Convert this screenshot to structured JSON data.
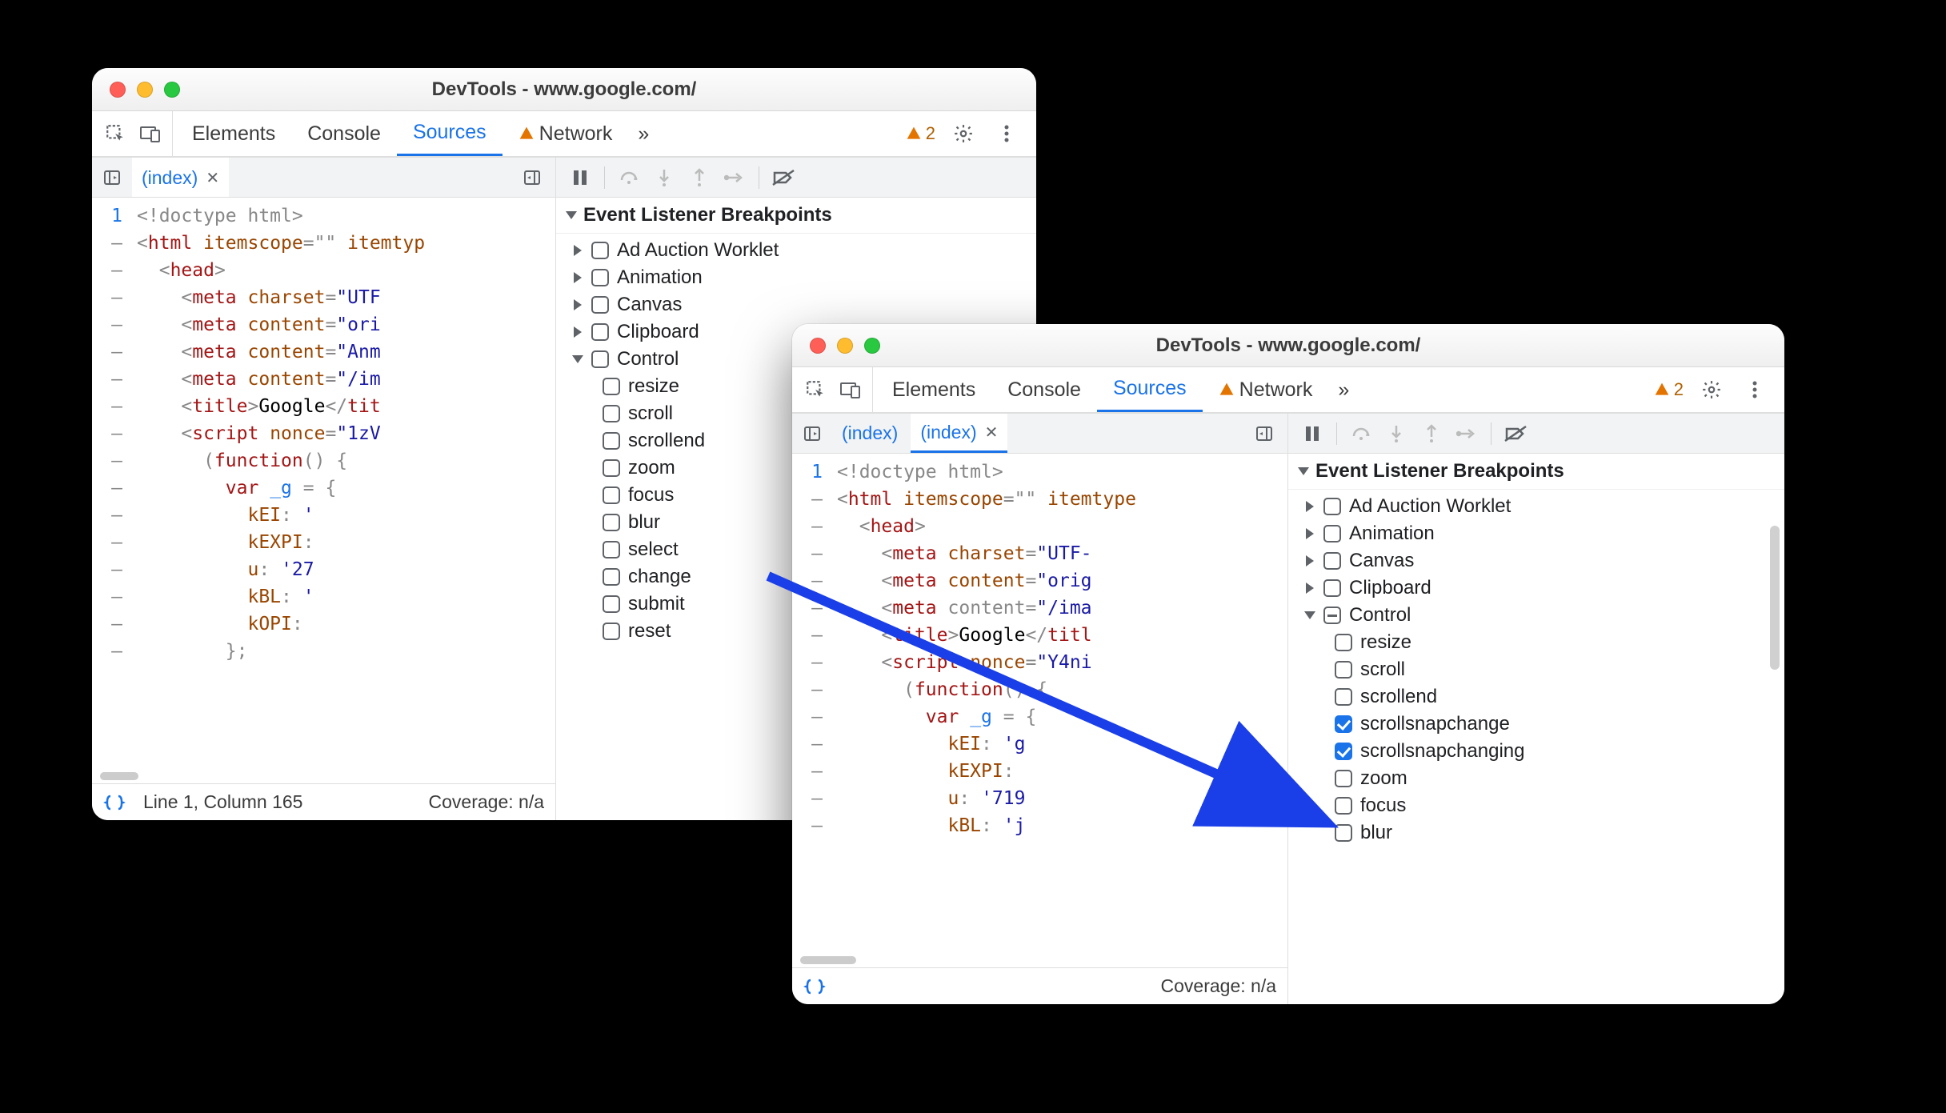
{
  "windows": {
    "w1": {
      "title": "DevTools - www.google.com/"
    },
    "w2": {
      "title": "DevTools - www.google.com/"
    }
  },
  "mainTabs": {
    "elements": "Elements",
    "console": "Console",
    "sources": "Sources",
    "network": "Network"
  },
  "warningCount": "2",
  "fileTabs": {
    "index": "(index)"
  },
  "footer": {
    "cursor": "Line 1, Column 165",
    "coverage": "Coverage: n/a"
  },
  "sectionTitle": "Event Listener Breakpoints",
  "categories": {
    "adAuction": "Ad Auction Worklet",
    "animation": "Animation",
    "canvas": "Canvas",
    "clipboard": "Clipboard",
    "control": "Control"
  },
  "controlItems": {
    "resize": "resize",
    "scroll": "scroll",
    "scrollend": "scrollend",
    "scrollsnapchange": "scrollsnapchange",
    "scrollsnapchanging": "scrollsnapchanging",
    "zoom": "zoom",
    "focus": "focus",
    "blur": "blur",
    "select": "select",
    "change": "change",
    "submit": "submit",
    "reset": "reset"
  },
  "code1": {
    "lines": [
      {
        "n": "1",
        "html": "<span class='c-gray'>&lt;!doctype html&gt;</span>"
      },
      {
        "n": "–",
        "html": "<span class='c-punc'>&lt;</span><span class='c-tag'>html</span> <span class='c-attr'>itemscope</span><span class='c-punc'>=\"\"</span> <span class='c-attr'>itemtyp</span>"
      },
      {
        "n": "–",
        "html": "  <span class='c-punc'>&lt;</span><span class='c-tag'>head</span><span class='c-punc'>&gt;</span>"
      },
      {
        "n": "–",
        "html": "    <span class='c-punc'>&lt;</span><span class='c-tag'>meta</span> <span class='c-attr'>charset</span><span class='c-punc'>=</span><span class='c-str'>\"UTF</span>"
      },
      {
        "n": "–",
        "html": "    <span class='c-punc'>&lt;</span><span class='c-tag'>meta</span> <span class='c-attr'>content</span><span class='c-punc'>=</span><span class='c-str'>\"ori</span>"
      },
      {
        "n": "–",
        "html": "    <span class='c-punc'>&lt;</span><span class='c-tag'>meta</span> <span class='c-attr'>content</span><span class='c-punc'>=</span><span class='c-str'>\"Anm</span>"
      },
      {
        "n": "–",
        "html": "    <span class='c-punc'>&lt;</span><span class='c-tag'>meta</span> <span class='c-attr'>content</span><span class='c-punc'>=</span><span class='c-str'>\"/im</span>"
      },
      {
        "n": "–",
        "html": "    <span class='c-punc'>&lt;</span><span class='c-tag'>title</span><span class='c-punc'>&gt;</span>Google<span class='c-punc'>&lt;/</span><span class='c-tag'>tit</span>"
      },
      {
        "n": "–",
        "html": "    <span class='c-punc'>&lt;</span><span class='c-tag'>script</span> <span class='c-attr'>nonce</span><span class='c-punc'>=</span><span class='c-str'>\"1zV</span>"
      },
      {
        "n": "–",
        "html": "      <span class='c-punc'>(</span><span class='c-kw'>function</span><span class='c-punc'>() {</span>"
      },
      {
        "n": "–",
        "html": "        <span class='c-kw'>var</span> <span class='c-var'>_g</span> <span class='c-punc'>= {</span>"
      },
      {
        "n": "–",
        "html": "          <span class='c-prop'>kEI</span><span class='c-punc'>:</span> <span class='c-str'>'</span>"
      },
      {
        "n": "–",
        "html": "          <span class='c-prop'>kEXPI</span><span class='c-punc'>:</span>"
      },
      {
        "n": "–",
        "html": "          <span class='c-prop'>u</span><span class='c-punc'>:</span> <span class='c-str'>'27</span>"
      },
      {
        "n": "–",
        "html": "          <span class='c-prop'>kBL</span><span class='c-punc'>:</span> <span class='c-str'>'</span>"
      },
      {
        "n": "–",
        "html": "          <span class='c-prop'>kOPI</span><span class='c-punc'>:</span>"
      },
      {
        "n": "–",
        "html": "        <span class='c-punc'>};</span>"
      }
    ]
  },
  "code2": {
    "lines": [
      {
        "n": "1",
        "html": "<span class='c-gray'>&lt;!doctype html&gt;</span>"
      },
      {
        "n": "–",
        "html": "<span class='c-punc'>&lt;</span><span class='c-tag'>html</span> <span class='c-attr'>itemscope</span><span class='c-punc'>=\"\"</span> <span class='c-attr'>itemtype</span>"
      },
      {
        "n": "–",
        "html": "  <span class='c-punc'>&lt;</span><span class='c-tag'>head</span><span class='c-punc'>&gt;</span>"
      },
      {
        "n": "–",
        "html": "    <span class='c-punc'>&lt;</span><span class='c-tag'>meta</span> <span class='c-attr'>charset</span><span class='c-punc'>=</span><span class='c-str'>\"UTF-</span>"
      },
      {
        "n": "–",
        "html": "    <span class='c-punc'>&lt;</span><span class='c-tag'>meta</span> <span class='c-attr'>content</span><span class='c-punc'>=</span><span class='c-str'>\"orig</span>"
      },
      {
        "n": "–",
        "html": "    <span class='c-punc'>&lt;</span><span class='c-tag'>meta</span> <span class='c-punc'>content</span><span class='c-punc'>=</span><span class='c-str'>\"/ima</span>"
      },
      {
        "n": "–",
        "html": "    <span class='c-punc'>&lt;</span><span class='c-tag'>title</span><span class='c-punc'>&gt;</span>Google<span class='c-punc'>&lt;/</span><span class='c-tag'>titl</span>"
      },
      {
        "n": "–",
        "html": "    <span class='c-punc'>&lt;</span><span class='c-tag'>script</span> <span class='c-attr'>nonce</span><span class='c-punc'>=</span><span class='c-str'>\"Y4ni</span>"
      },
      {
        "n": "–",
        "html": "      <span class='c-punc'>(</span><span class='c-kw'>function</span><span class='c-punc'>() {</span>"
      },
      {
        "n": "–",
        "html": "        <span class='c-kw'>var</span> <span class='c-var'>_g</span> <span class='c-punc'>= {</span>"
      },
      {
        "n": "–",
        "html": "          <span class='c-prop'>kEI</span><span class='c-punc'>:</span> <span class='c-str'>'g</span>"
      },
      {
        "n": "–",
        "html": "          <span class='c-prop'>kEXPI</span><span class='c-punc'>:</span>"
      },
      {
        "n": "–",
        "html": "          <span class='c-prop'>u</span><span class='c-punc'>:</span> <span class='c-str'>'719</span>"
      },
      {
        "n": "–",
        "html": "          <span class='c-prop'>kBL</span><span class='c-punc'>:</span> <span class='c-str'>'j</span>"
      }
    ]
  }
}
